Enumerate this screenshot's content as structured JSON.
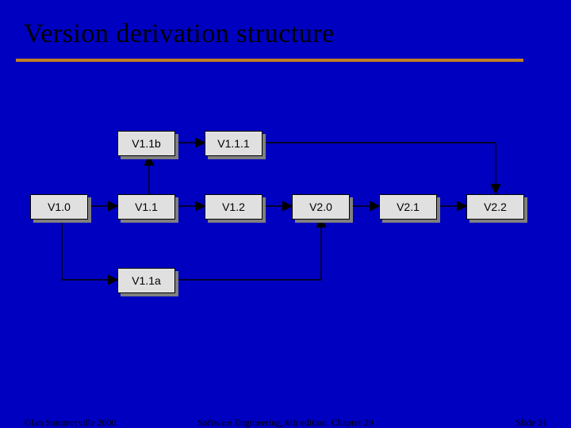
{
  "title": "Version derivation structure",
  "nodes": {
    "v10": "V1.0",
    "v11": "V1.1",
    "v12": "V1.2",
    "v20": "V2.0",
    "v21": "V2.1",
    "v22": "V2.2",
    "v11b": "V1.1b",
    "v111": "V1.1.1",
    "v11a": "V1.1a"
  },
  "footer": {
    "left": "©Ian Sommerville 2000",
    "center": "Software Engineering, 6th edition. Chapter 29",
    "right": "Slide 31"
  }
}
